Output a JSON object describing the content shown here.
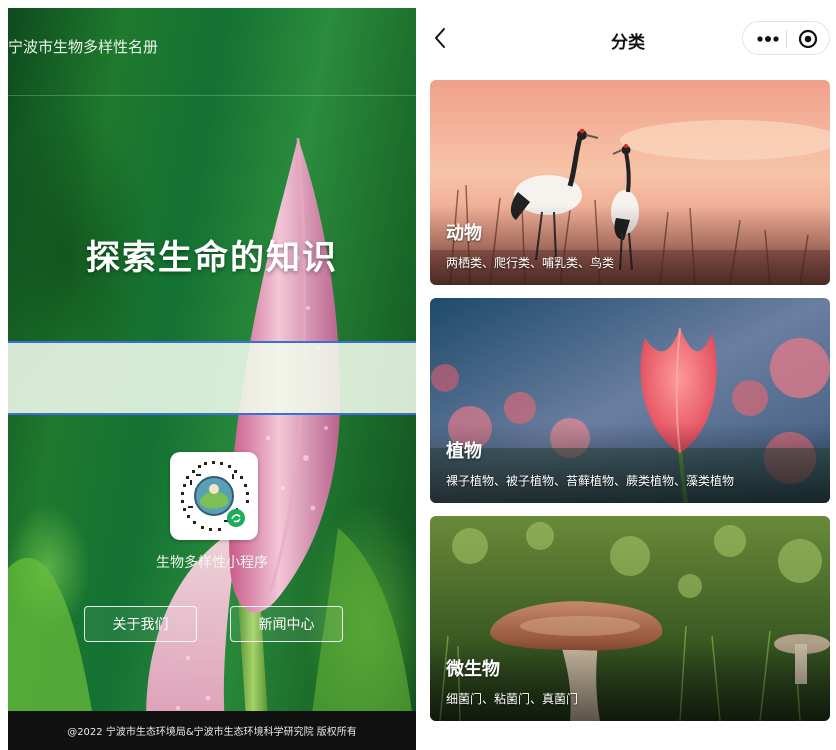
{
  "left": {
    "app_title": "宁波市生物多样性名册",
    "hero_text": "探索生命的知识",
    "mini_program_caption": "生物多样性小程序",
    "buttons": {
      "about": "关于我们",
      "news": "新闻中心"
    },
    "footer": "@2022 宁波市生态环境局&宁波市生态环境科学研究院 版权所有"
  },
  "right": {
    "nav_title": "分类",
    "icons": {
      "back": "back-chevron-icon",
      "more": "more-dots-icon",
      "close": "target-circle-icon"
    },
    "categories": [
      {
        "title": "动物",
        "subtitle": "两栖类、爬行类、哺乳类、鸟类",
        "image": "red-crowned-cranes"
      },
      {
        "title": "植物",
        "subtitle": "裸子植物、被子植物、苔藓植物、蕨类植物、藻类植物",
        "image": "pink-tulip"
      },
      {
        "title": "微生物",
        "subtitle": "细菌门、粘菌门、真菌门",
        "image": "mushroom"
      }
    ]
  }
}
